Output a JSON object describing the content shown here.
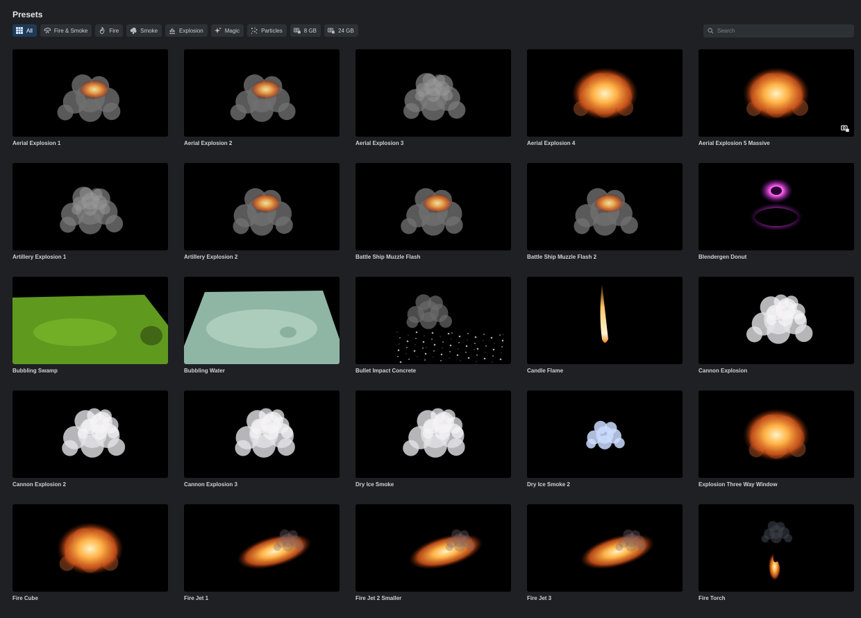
{
  "header": {
    "title": "Presets"
  },
  "filters": [
    {
      "label": "All",
      "icon": "grid-icon",
      "active": true
    },
    {
      "label": "Fire & Smoke",
      "icon": "fire-smoke-icon",
      "active": false
    },
    {
      "label": "Fire",
      "icon": "flame-icon",
      "active": false
    },
    {
      "label": "Smoke",
      "icon": "smoke-cloud-icon",
      "active": false
    },
    {
      "label": "Explosion",
      "icon": "explosion-icon",
      "active": false
    },
    {
      "label": "Magic",
      "icon": "sparkle-icon",
      "active": false
    },
    {
      "label": "Particles",
      "icon": "particles-icon",
      "active": false
    },
    {
      "label": "8 GB",
      "icon": "gpu-memory-icon",
      "active": false
    },
    {
      "label": "24 GB",
      "icon": "gpu-memory-icon",
      "active": false
    }
  ],
  "search": {
    "placeholder": "Search",
    "value": ""
  },
  "colors": {
    "background": "#1e2023",
    "chip": "#2d3034",
    "chip_active": "#1f3a57",
    "thumb_bg": "#000000"
  },
  "presets": [
    {
      "label": "Aerial Explosion 1",
      "thumb": "explosion-smoke"
    },
    {
      "label": "Aerial Explosion 2",
      "thumb": "explosion-smoke"
    },
    {
      "label": "Aerial Explosion 3",
      "thumb": "smoke"
    },
    {
      "label": "Aerial Explosion 4",
      "thumb": "fireball"
    },
    {
      "label": "Aerial Explosion 5 Massive",
      "thumb": "fireball",
      "badge": "gpu-memory-icon"
    },
    {
      "label": "Artillery Explosion 1",
      "thumb": "smoke"
    },
    {
      "label": "Artillery Explosion 2",
      "thumb": "explosion-smoke"
    },
    {
      "label": "Battle Ship Muzzle Flash",
      "thumb": "explosion-smoke"
    },
    {
      "label": "Battle Ship Muzzle Flash 2",
      "thumb": "explosion-smoke"
    },
    {
      "label": "Blendergen Donut",
      "thumb": "magic-donut"
    },
    {
      "label": "Bubbling Swamp",
      "thumb": "green-plane"
    },
    {
      "label": "Bubbling Water",
      "thumb": "water-plane"
    },
    {
      "label": "Bullet Impact Concrete",
      "thumb": "particles"
    },
    {
      "label": "Candle Flame",
      "thumb": "candle"
    },
    {
      "label": "Cannon Explosion",
      "thumb": "white-smoke"
    },
    {
      "label": "Cannon Explosion 2",
      "thumb": "white-smoke"
    },
    {
      "label": "Cannon Explosion 3",
      "thumb": "white-smoke"
    },
    {
      "label": "Dry Ice Smoke",
      "thumb": "white-smoke"
    },
    {
      "label": "Dry Ice Smoke 2",
      "thumb": "blue-smoke"
    },
    {
      "label": "Explosion Three Way Window",
      "thumb": "fireball"
    },
    {
      "label": "Fire Cube",
      "thumb": "fireball"
    },
    {
      "label": "Fire Jet 1",
      "thumb": "fire-jet"
    },
    {
      "label": "Fire Jet 2 Smaller",
      "thumb": "fire-jet"
    },
    {
      "label": "Fire Jet 3",
      "thumb": "fire-jet"
    },
    {
      "label": "Fire Torch",
      "thumb": "torch"
    }
  ]
}
